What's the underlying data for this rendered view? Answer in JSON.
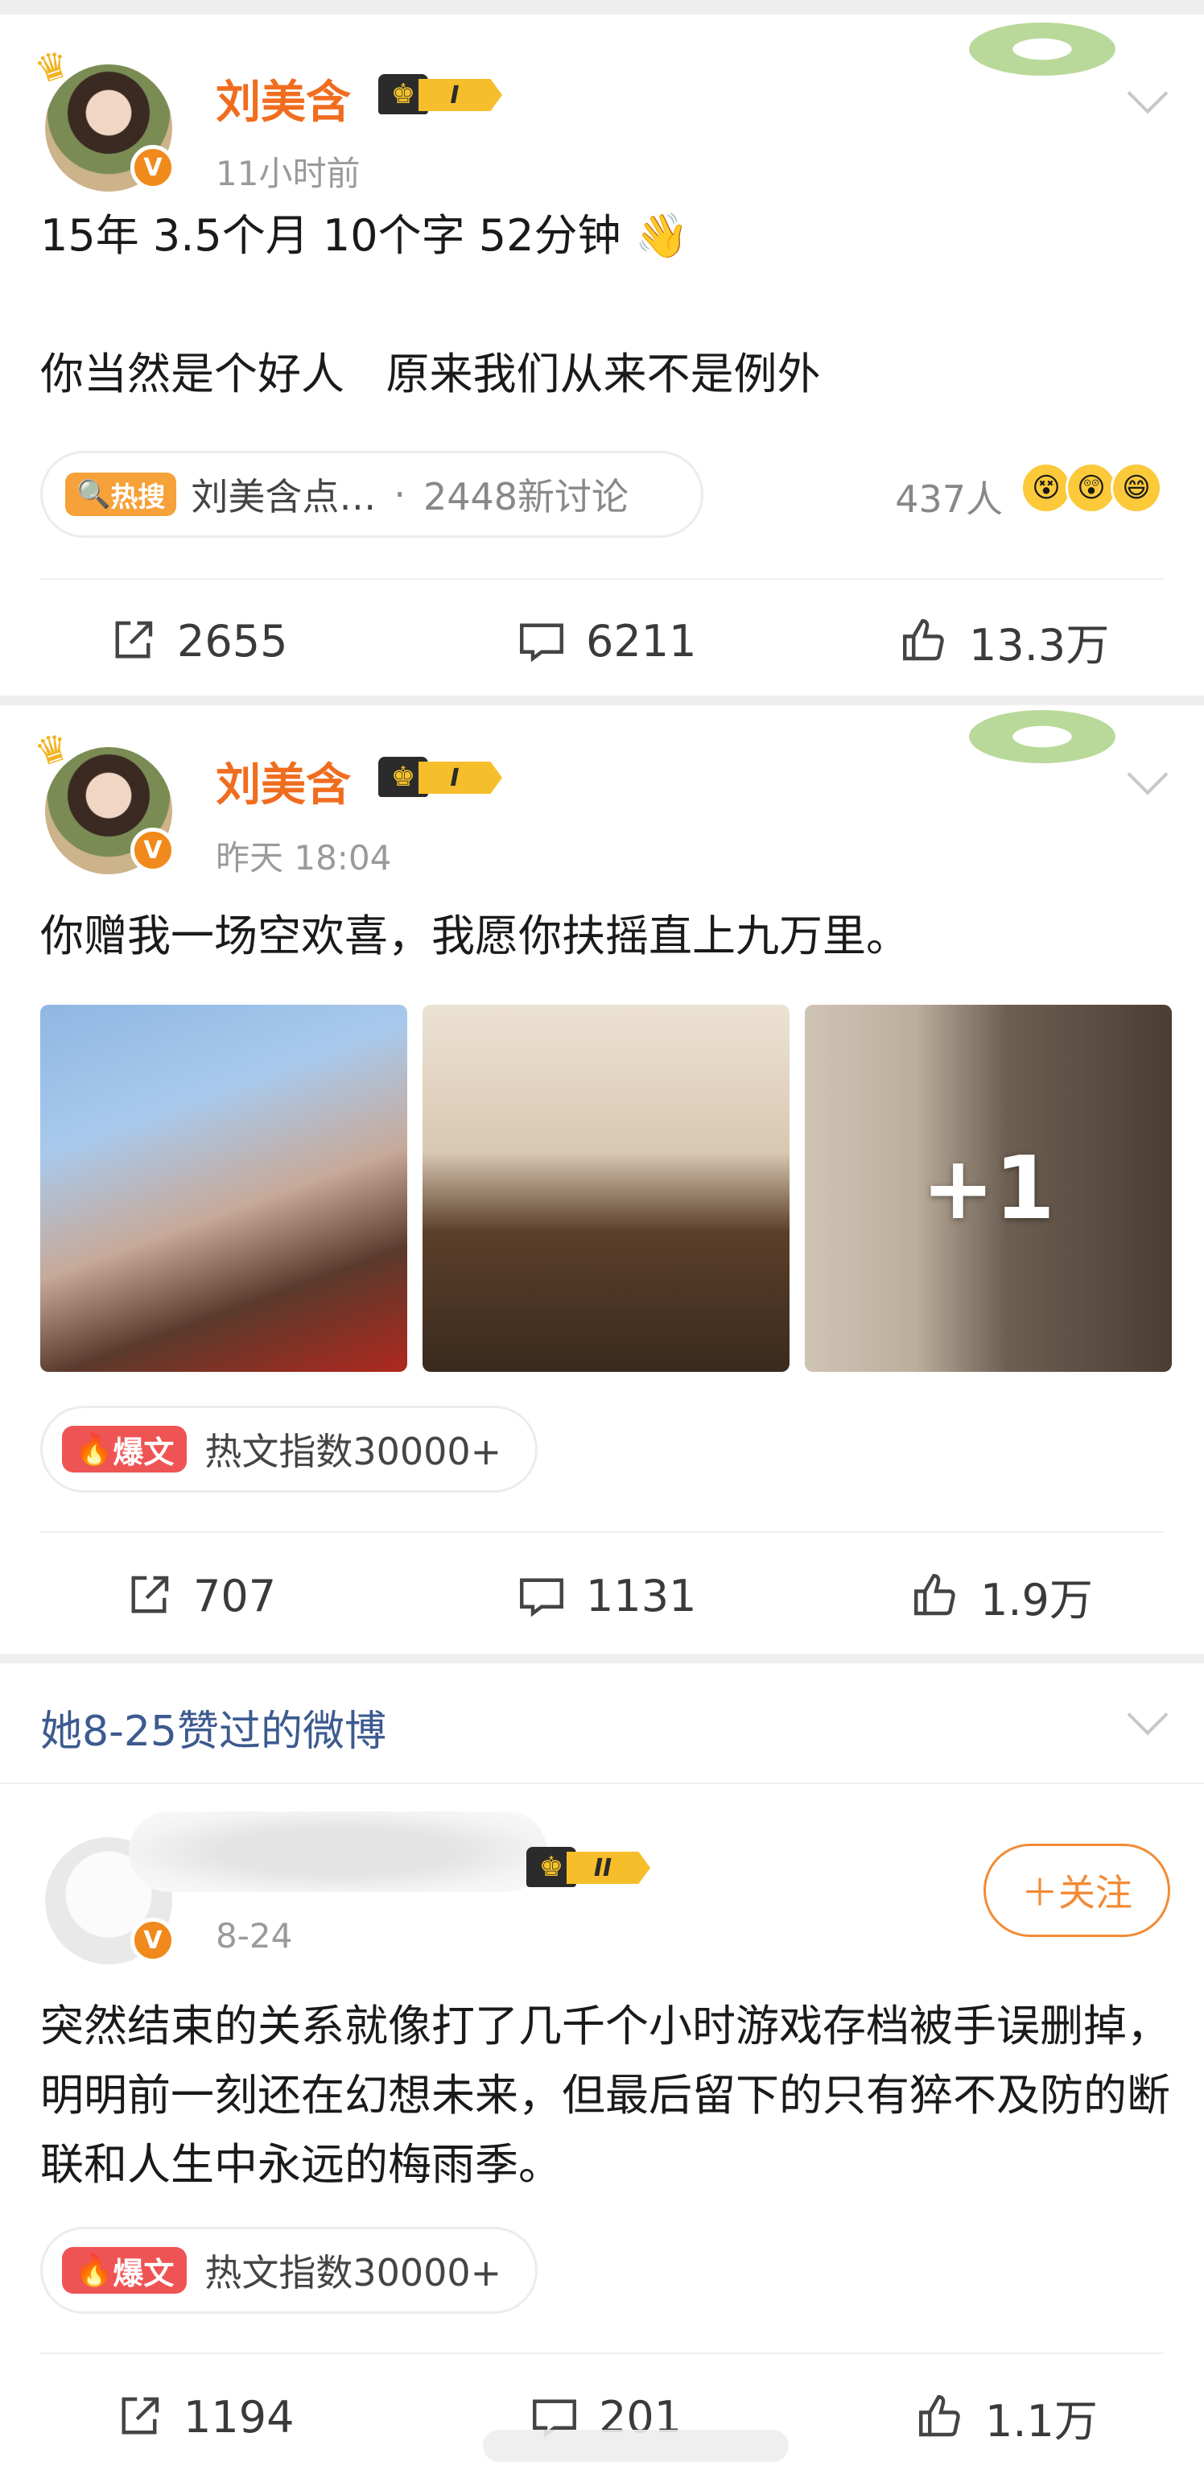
{
  "posts": [
    {
      "author": "刘美含",
      "level": "I",
      "time": "11小时前",
      "text": "15年 3.5个月 10个字 52分钟 👋\n\n你当然是个好人   原来我们从来不是例外",
      "topic": {
        "tag": "热搜",
        "title": "刘美含点…",
        "discussions": "2448新讨论"
      },
      "participants": "437人",
      "emojis": [
        "😵",
        "😲",
        "😄"
      ],
      "actions": {
        "share": "2655",
        "comment": "6211",
        "like": "13.3万"
      }
    },
    {
      "author": "刘美含",
      "level": "I",
      "time": "昨天 18:04",
      "text": "你赠我一场空欢喜，我愿你扶摇直上九万里。",
      "photos_more": "+1",
      "badge": {
        "tag": "爆文",
        "label": "热文指数30000+"
      },
      "actions": {
        "share": "707",
        "comment": "1131",
        "like": "1.9万"
      }
    },
    {
      "level": "II",
      "time": "8-24",
      "text": "突然结束的关系就像打了几千个小时游戏存档被手误删掉，明明前一刻还在幻想未来，但最后留下的只有猝不及防的断联和人生中永远的梅雨季。",
      "follow": "＋关注",
      "badge": {
        "tag": "爆文",
        "label": "热文指数30000+"
      },
      "actions": {
        "share": "1194",
        "comment": "201",
        "like": "1.1万"
      }
    }
  ],
  "liked_section": {
    "title": "她8-25赞过的微博"
  },
  "colors": {
    "name": "#f06d1f",
    "section": "#3c5a8f",
    "follow": "#f28b35",
    "boom": "#ef5454",
    "hot": "#f6a13a"
  }
}
